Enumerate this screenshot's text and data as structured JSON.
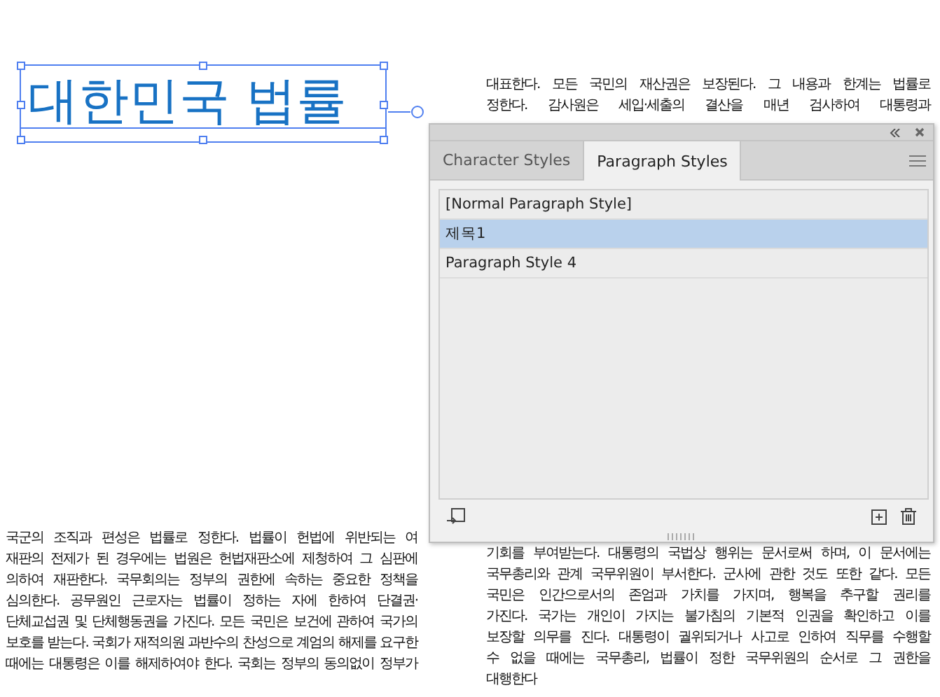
{
  "title_frame": {
    "text": "대한민국 법률",
    "selected": true
  },
  "text_frames": [
    {
      "kind": "top_right",
      "lines": [
        "대표한다. 모든 국민의 재산권은 보장된다. 그 내용과 한계는 법률로",
        "정한다. 감사원은 세입·세출의 결산을 매년 검사하여 대통령과"
      ]
    },
    {
      "kind": "bottom_left",
      "lines": [
        "국군의 조직과 편성은 법률로 정한다. 법률이 헌법에 위반되는 여",
        "재판의 전제가 된 경우에는 법원은 헌법재판소에 제청하여 그 심판에",
        "의하여 재판한다. 국무회의는 정부의 권한에 속하는 중요한 정책을",
        "심의한다. 공무원인 근로자는 법률이 정하는 자에 한하여 단결권·",
        "단체교섭권 및 단체행동권을 가진다. 모든 국민은 보건에 관하여 국가의",
        "보호를 받는다. 국회가 재적의원 과반수의 찬성으로 계엄의 해제를 요구한",
        "때에는 대통령은 이를 해제하여야 한다. 국회는 정부의 동의없이 정부가"
      ]
    },
    {
      "kind": "bottom_right",
      "lines": [
        "기회를 부여받는다. 대통령의 국법상 행위는 문서로써 하며, 이 문서에는",
        "국무총리와 관계 국무위원이 부서한다. 군사에 관한 것도 또한 같다. 모든",
        "국민은 인간으로서의 존엄과 가치를 가지며, 행복을 추구할 권리를",
        "가진다. 국가는 개인이 가지는 불가침의 기본적 인권을 확인하고 이를",
        "보장할 의무를 진다. 대통령이 궐위되거나 사고로 인하여 직무를 수행할",
        "수 없을 때에는 국무총리, 법률이 정한 국무위원의 순서로 그 권한을",
        "대행한다"
      ]
    }
  ],
  "panel": {
    "tabs": [
      {
        "label": "Character Styles",
        "selected": false
      },
      {
        "label": "Paragraph Styles",
        "selected": true
      }
    ],
    "styles": [
      {
        "label": "[Normal Paragraph Style]",
        "selected": false
      },
      {
        "label": "제목1",
        "selected": true
      },
      {
        "label": "Paragraph Style 4",
        "selected": false
      }
    ]
  }
}
